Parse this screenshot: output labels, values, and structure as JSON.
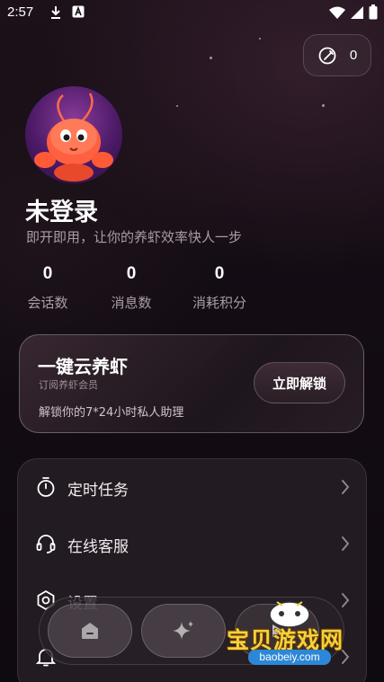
{
  "status_bar": {
    "time": "2:57"
  },
  "points": {
    "value": "0"
  },
  "profile": {
    "username": "未登录",
    "tagline": "即开即用，让你的养虾效率快人一步"
  },
  "stats": [
    {
      "value": "0",
      "label": "会话数"
    },
    {
      "value": "0",
      "label": "消息数"
    },
    {
      "value": "0",
      "label": "消耗积分"
    }
  ],
  "promo": {
    "title": "一键云养虾",
    "subtitle": "订阅养虾会员",
    "description": "解锁你的7*24小时私人助理",
    "button_label": "立即解锁"
  },
  "menu": {
    "items": [
      {
        "label": "定时任务",
        "icon": "stopwatch-icon"
      },
      {
        "label": "在线客服",
        "icon": "headset-icon"
      },
      {
        "label": "设置",
        "icon": "gear-icon"
      },
      {
        "label": "",
        "icon": "bell-icon"
      }
    ]
  },
  "bottom_nav": {
    "items": [
      {
        "icon": "home-icon"
      },
      {
        "icon": "sparkle-icon"
      },
      {
        "icon": "profile-icon"
      }
    ]
  },
  "watermark": {
    "text": "宝贝游戏网",
    "url": "baobeiy.com"
  },
  "colors": {
    "background": "#120c14",
    "muted_text": "#a99ca6",
    "watermark_yellow": "#f3d23c",
    "watermark_blue": "#2c88d6"
  }
}
